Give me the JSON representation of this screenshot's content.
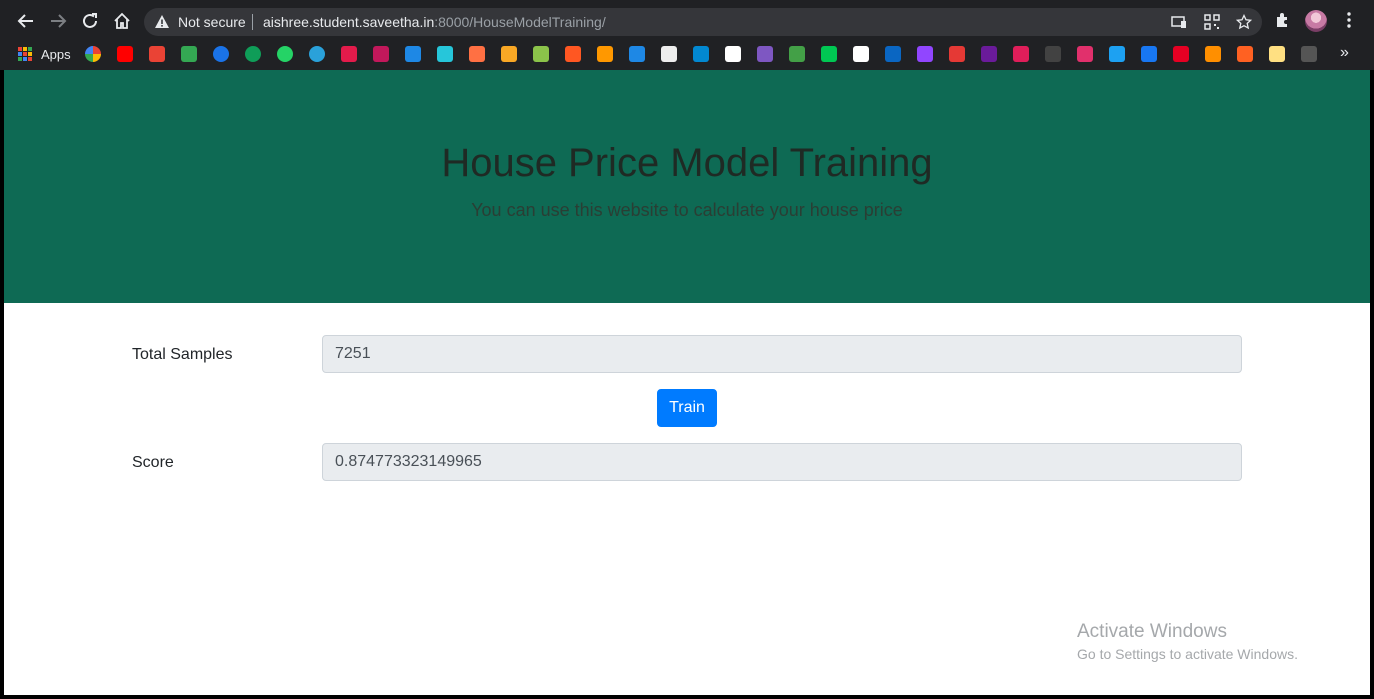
{
  "browser": {
    "security_label": "Not secure",
    "url_host": "aishree.student.saveetha.in",
    "url_path": ":8000/HouseModelTraining/",
    "nav_icons": [
      "back-icon",
      "forward-icon",
      "reload-icon",
      "home-icon"
    ],
    "omnibox_icons": [
      "cast-icon",
      "qr-code-icon",
      "star-icon"
    ],
    "right_icons": [
      "extensions-icon",
      "avatar",
      "menu-icon"
    ]
  },
  "bookmarks": {
    "apps_label": "Apps",
    "items": [
      {
        "name": "google-icon",
        "color": "#ffffff"
      },
      {
        "name": "youtube-icon",
        "color": "#ff0000"
      },
      {
        "name": "gmail-icon",
        "color": "#ea4335"
      },
      {
        "name": "drive-icon",
        "color": "#34a853"
      },
      {
        "name": "meet-icon",
        "color": "#1a73e8"
      },
      {
        "name": "hangouts-icon",
        "color": "#0f9d58"
      },
      {
        "name": "whatsapp-icon",
        "color": "#25d366"
      },
      {
        "name": "telegram-icon",
        "color": "#2aa1da"
      },
      {
        "name": "m-icon",
        "color": "#e31b4b"
      },
      {
        "name": "u-icon",
        "color": "#c2185b"
      },
      {
        "name": "g-icon",
        "color": "#1e88e5"
      },
      {
        "name": "w-icon",
        "color": "#26c6da"
      },
      {
        "name": "flame-icon",
        "color": "#ff7043"
      },
      {
        "name": "e-icon",
        "color": "#f9a825"
      },
      {
        "name": "mountain-icon",
        "color": "#8bc34a"
      },
      {
        "name": "s-icon",
        "color": "#ff5722"
      },
      {
        "name": "cube-icon",
        "color": "#ff9800"
      },
      {
        "name": "k-icon",
        "color": "#1e88e5"
      },
      {
        "name": "chart-icon",
        "color": "#eeeeee"
      },
      {
        "name": "play-icon",
        "color": "#0288d1"
      },
      {
        "name": "x-icon",
        "color": "#ffffff"
      },
      {
        "name": "heart-icon",
        "color": "#7e57c2"
      },
      {
        "name": "code-icon",
        "color": "#43a047"
      },
      {
        "name": "hh-icon",
        "color": "#00c853"
      },
      {
        "name": "cloud-icon",
        "color": "#ffffff"
      },
      {
        "name": "linkedin-icon",
        "color": "#0a66c2"
      },
      {
        "name": "twitch-icon",
        "color": "#9146ff"
      },
      {
        "name": "calendar-icon",
        "color": "#e53935"
      },
      {
        "name": "p-icon",
        "color": "#6a1b9a"
      },
      {
        "name": "slack-icon",
        "color": "#e01e5a"
      },
      {
        "name": "grid-icon",
        "color": "#424242"
      },
      {
        "name": "instagram-icon",
        "color": "#e1306c"
      },
      {
        "name": "twitter-icon",
        "color": "#1da1f2"
      },
      {
        "name": "facebook-icon",
        "color": "#1877f2"
      },
      {
        "name": "pinterest-icon",
        "color": "#e60023"
      },
      {
        "name": "blogger-icon",
        "color": "#ff8f00"
      },
      {
        "name": "wattpad-icon",
        "color": "#ff6122"
      },
      {
        "name": "pencil-icon",
        "color": "#ffe082"
      },
      {
        "name": "github-icon",
        "color": "#555555"
      }
    ],
    "more_label": "»"
  },
  "hero": {
    "title": "House Price Model Training",
    "subtitle": "You can use this website to calculate your house price",
    "background": "#0e6a54"
  },
  "form": {
    "total_samples_label": "Total Samples",
    "total_samples_value": "7251",
    "train_button": "Train",
    "score_label": "Score",
    "score_value": "0.874773323149965",
    "button_color": "#007bff"
  },
  "watermark": {
    "title": "Activate Windows",
    "subtitle": "Go to Settings to activate Windows."
  }
}
